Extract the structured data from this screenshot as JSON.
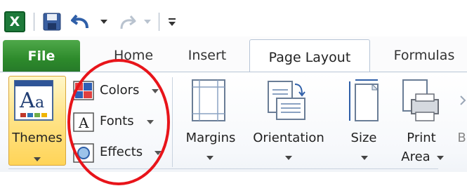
{
  "app": {
    "icon_letter": "X"
  },
  "tabs": {
    "file": "File",
    "home": "Home",
    "insert": "Insert",
    "page_layout": "Page Layout",
    "formulas": "Formulas"
  },
  "themes_group": {
    "themes": "Themes",
    "colors": "Colors",
    "fonts": "Fonts",
    "effects": "Effects"
  },
  "page_setup_group": {
    "margins": "Margins",
    "orientation": "Orientation",
    "size": "Size",
    "print_area_line1": "Print",
    "print_area_line2": "Area"
  },
  "overflow_letter": "B",
  "colors": {
    "file_tab": "#2d8a2b",
    "highlight": "#ffd458",
    "annotation": "#e8141a"
  }
}
